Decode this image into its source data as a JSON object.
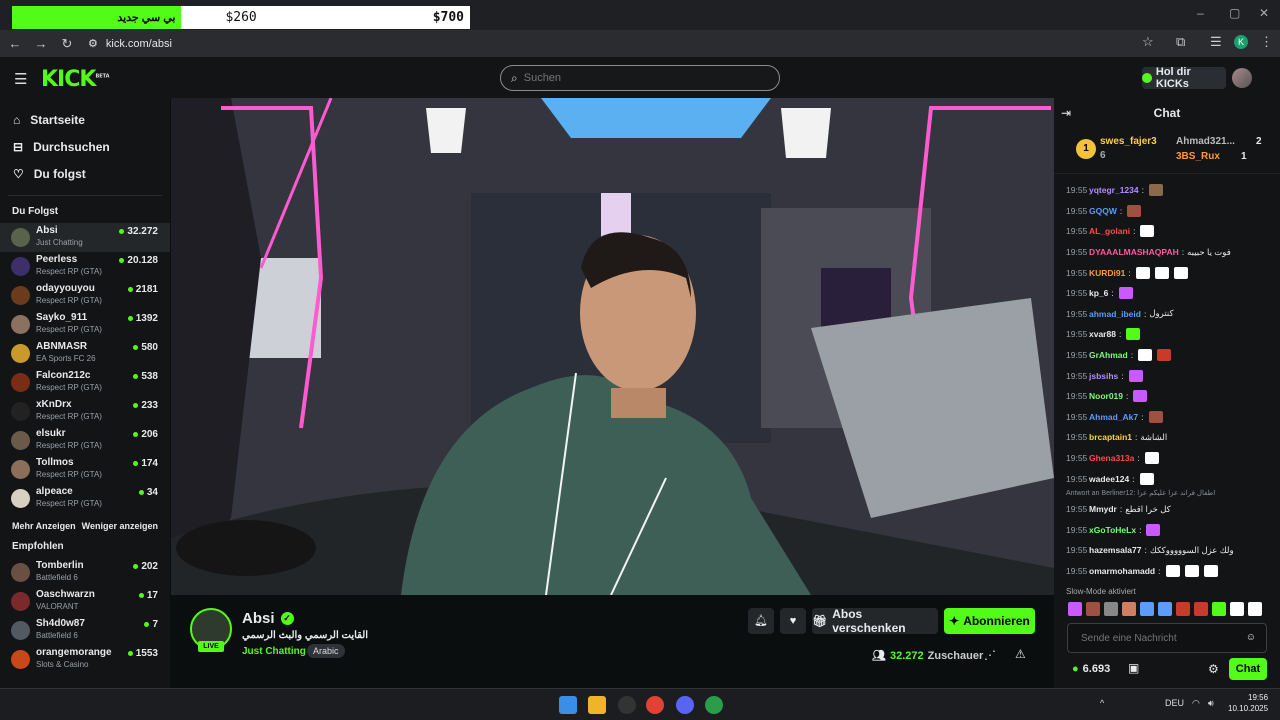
{
  "browser": {
    "goal_label": "بي سي جديد",
    "goal_mid": "$260",
    "goal_max": "$700",
    "goal_progress": 0.37,
    "url": "kick.com/absi",
    "profile_initial": "K"
  },
  "header": {
    "logo": "KICK",
    "logo_badge": "BETA",
    "search_placeholder": "Suchen",
    "kicks_button": "Hol dir KICKs"
  },
  "sidebar": {
    "nav": [
      {
        "label": "Startseite",
        "icon": "home-icon"
      },
      {
        "label": "Durchsuchen",
        "icon": "browse-icon"
      },
      {
        "label": "Du folgst",
        "icon": "heart-icon"
      }
    ],
    "following_title": "Du Folgst",
    "following": [
      {
        "name": "Absi",
        "category": "Just Chatting",
        "viewers": "32.272",
        "color": "#59624a"
      },
      {
        "name": "Peerless",
        "category": "Respect RP (GTA)",
        "viewers": "20.128",
        "color": "#3c2f6a"
      },
      {
        "name": "odayyouyou",
        "category": "Respect RP (GTA)",
        "viewers": "2181",
        "color": "#6b3b1b"
      },
      {
        "name": "Sayko_911",
        "category": "Respect RP (GTA)",
        "viewers": "1392",
        "color": "#8a7160"
      },
      {
        "name": "ABNMASR",
        "category": "EA Sports FC 26",
        "viewers": "580",
        "color": "#c89a2a"
      },
      {
        "name": "Falcon212c",
        "category": "Respect RP (GTA)",
        "viewers": "538",
        "color": "#7a2c16"
      },
      {
        "name": "xKnDrx",
        "category": "Respect RP (GTA)",
        "viewers": "233",
        "color": "#222"
      },
      {
        "name": "elsukr",
        "category": "Respect RP (GTA)",
        "viewers": "206",
        "color": "#6a5a4a"
      },
      {
        "name": "Tollmos",
        "category": "Respect RP (GTA)",
        "viewers": "174",
        "color": "#8b6f5a"
      },
      {
        "name": "alpeace",
        "category": "Respect RP (GTA)",
        "viewers": "34",
        "color": "#d8d0c0"
      }
    ],
    "show_more": "Mehr Anzeigen",
    "show_less": "Weniger anzeigen",
    "recommended_title": "Empfohlen",
    "recommended": [
      {
        "name": "Tomberlin",
        "category": "Battlefield 6",
        "viewers": "202",
        "color": "#6a5040"
      },
      {
        "name": "Oaschwarzn",
        "category": "VALORANT",
        "viewers": "17",
        "color": "#7a2a2a"
      },
      {
        "name": "Sh4d0w87",
        "category": "Battlefield 6",
        "viewers": "7",
        "color": "#505a60"
      },
      {
        "name": "orangemorange",
        "category": "Slots & Casino",
        "viewers": "1553",
        "color": "#c8481a"
      }
    ]
  },
  "stream": {
    "name": "Absi",
    "title": "القايت الرسمي والبث الرسمي",
    "category": "Just Chatting",
    "tag": "Arabic",
    "live": "LIVE",
    "viewers": "32.272",
    "viewers_label": "Zuschauer",
    "gift_label": "Abos verschenken",
    "subscribe_label": "Abonnieren"
  },
  "chat": {
    "title": "Chat",
    "leaderboard": {
      "first": {
        "rank": "1",
        "name": "swes_fajer3",
        "count": "6"
      },
      "second": {
        "name": "Ahmad321...",
        "count": "2"
      },
      "third": {
        "name": "3BS_Rux",
        "count": "1"
      }
    },
    "messages": [
      {
        "time": "19:55",
        "user": "yqtegr_1234",
        "color": "#b48cff",
        "text": "",
        "emotes": [
          "#8a6a4a"
        ]
      },
      {
        "time": "19:55",
        "user": "GQQW",
        "color": "#5b9cff",
        "text": "",
        "emotes": [
          "#a05040"
        ]
      },
      {
        "time": "19:55",
        "user": "AL_golani",
        "color": "#ff4a4a",
        "text": "",
        "emotes": [
          "#ffffff"
        ]
      },
      {
        "time": "19:55",
        "user": "DYAAALMASHAQPAH",
        "color": "#ff5aa0",
        "text": "فوت يا حبيبه",
        "emotes": []
      },
      {
        "time": "19:55",
        "user": "KURDi91",
        "color": "#ff9a3a",
        "text": "",
        "emotes": [
          "#ffffff",
          "#ffffff",
          "#ffffff"
        ]
      },
      {
        "time": "19:55",
        "user": "kp_6",
        "color": "#e8eaec",
        "text": "",
        "emotes": [
          "#c85aff"
        ]
      },
      {
        "time": "19:55",
        "user": "ahmad_ibeid",
        "color": "#5b9cff",
        "text": "كنترول",
        "emotes": []
      },
      {
        "time": "19:55",
        "user": "xvar88",
        "color": "#e8eaec",
        "text": "",
        "emotes": [
          "#53fc18"
        ]
      },
      {
        "time": "19:55",
        "user": "GrAhmad",
        "color": "#7cfc7c",
        "text": "",
        "emotes": [
          "#ffffff",
          "#c83a2a"
        ]
      },
      {
        "time": "19:55",
        "user": "jsbsihs",
        "color": "#b48cff",
        "text": "",
        "emotes": [
          "#c85aff"
        ]
      },
      {
        "time": "19:55",
        "user": "Noor019",
        "color": "#7cfc7c",
        "text": "",
        "emotes": [
          "#c85aff"
        ]
      },
      {
        "time": "19:55",
        "user": "Ahmad_Ak7",
        "color": "#5b9cff",
        "text": "",
        "emotes": [
          "#a05040"
        ]
      },
      {
        "time": "19:55",
        "user": "brcaptain1",
        "color": "#ffd23a",
        "text": "الشاشة",
        "emotes": []
      },
      {
        "time": "19:55",
        "user": "Ghena313a",
        "color": "#ff4a4a",
        "text": "",
        "emotes": [
          "#ffffff"
        ]
      },
      {
        "time": "19:55",
        "user": "wadee124",
        "color": "#e8eaec",
        "text": "",
        "emotes": [
          "#ffffff"
        ]
      }
    ],
    "reply": {
      "label": "Antwort an Berliner12: اطفال فراند عزا عليكم عزا"
    },
    "messages2": [
      {
        "time": "19:55",
        "user": "Mmydr",
        "color": "#e8eaec",
        "text": "كل خرا اقطع",
        "emotes": []
      },
      {
        "time": "19:55",
        "user": "xGoToHeLx",
        "color": "#7cfc7c",
        "text": "",
        "emotes": [
          "#c85aff"
        ]
      },
      {
        "time": "19:55",
        "user": "hazemsala77",
        "color": "#e8eaec",
        "text": "ولك عزل السوووووككك",
        "emotes": []
      },
      {
        "time": "19:55",
        "user": "omarmohamadd",
        "color": "#e8eaec",
        "text": "",
        "emotes": [
          "#ffffff",
          "#ffffff",
          "#ffffff"
        ]
      }
    ],
    "slow_mode": "Slow-Mode aktiviert",
    "emote_bar": [
      "#c85aff",
      "#a05040",
      "#888",
      "#d08060",
      "#5b9cff",
      "#5b9cff",
      "#c83a2a",
      "#c83a2a",
      "#53fc18",
      "#ffffff",
      "#ffffff"
    ],
    "input_placeholder": "Sende eine Nachricht",
    "points": "6.693",
    "send_label": "Chat"
  },
  "taskbar": {
    "time": "19:56",
    "date": "10.10.2025",
    "lang": "DEU"
  }
}
